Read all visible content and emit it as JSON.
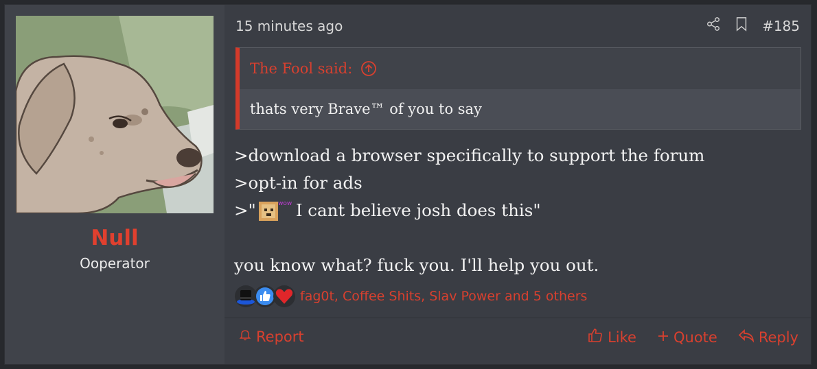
{
  "post": {
    "time": "15 minutes ago",
    "number": "#185"
  },
  "user": {
    "name": "Null",
    "title": "Ooperator"
  },
  "quote": {
    "author": "The Fool said:",
    "text": "thats very Brave™ of you to say"
  },
  "body": {
    "line1": ">download a browser specifically to support the forum",
    "line2": ">opt-in for ads",
    "line3_prefix": ">\"",
    "doge_text": "wow",
    "line3_suffix": " I cant believe josh does this\"",
    "line4": "you know what? fuck you. I'll help you out."
  },
  "reactions": {
    "users": "fag0t, Coffee Shits, Slav Power and 5 others",
    "icons": [
      "top-hat-icon",
      "thumbs-up-icon",
      "heart-icon"
    ]
  },
  "actions": {
    "report": "Report",
    "like": "Like",
    "quote": "Quote",
    "reply": "Reply"
  },
  "colors": {
    "accent": "#d8402f",
    "background": "#3a3d44",
    "user_cell": "#40434a"
  }
}
